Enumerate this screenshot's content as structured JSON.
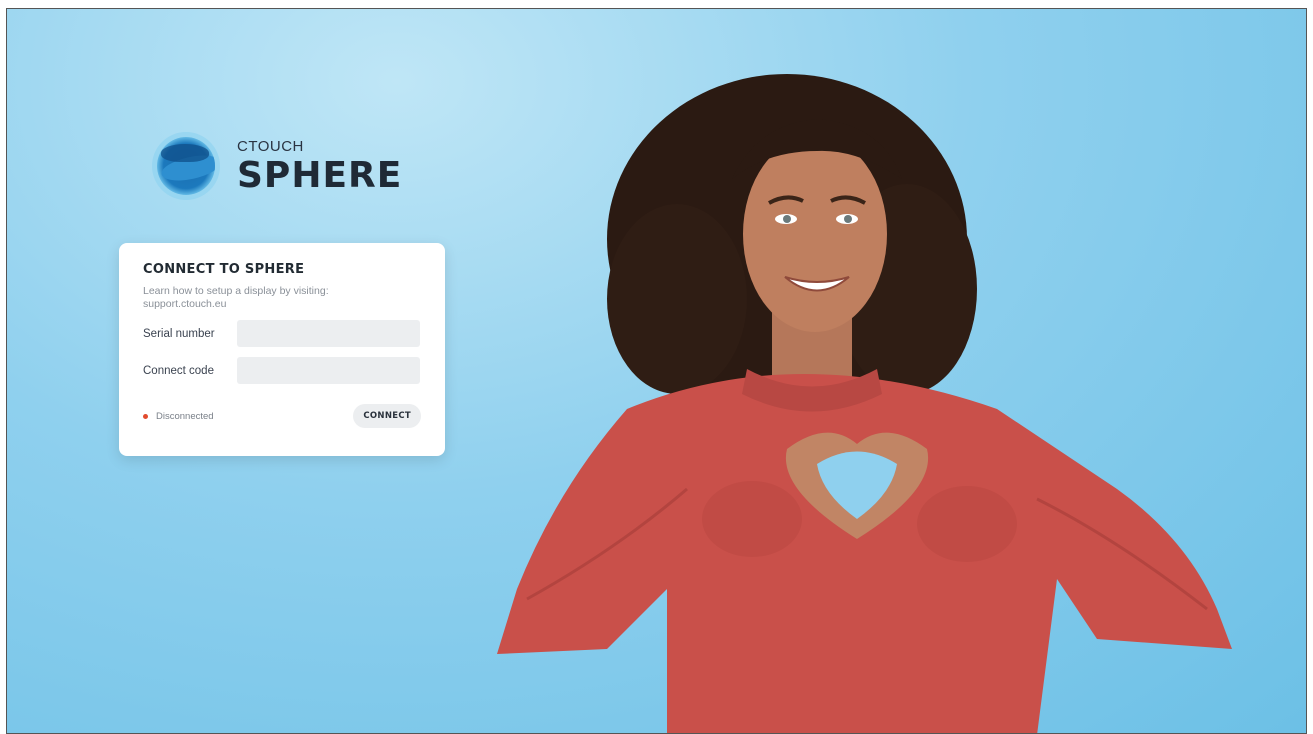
{
  "brand": {
    "small": "CTOUCH",
    "big": "SPHERE"
  },
  "card": {
    "title": "CONNECT TO SPHERE",
    "description": "Learn how to setup a display by visiting: support.ctouch.eu",
    "fields": [
      {
        "label": "Serial number",
        "value": "",
        "placeholder": ""
      },
      {
        "label": "Connect code",
        "value": "",
        "placeholder": ""
      }
    ],
    "status": "Disconnected",
    "connect_label": "CONNECT"
  },
  "colors": {
    "background": "#8fd0ee",
    "status_dot": "#e24b2e",
    "sweater": "#c9504a"
  },
  "photo": {
    "subject": "smiling woman making a heart shape with hands"
  }
}
